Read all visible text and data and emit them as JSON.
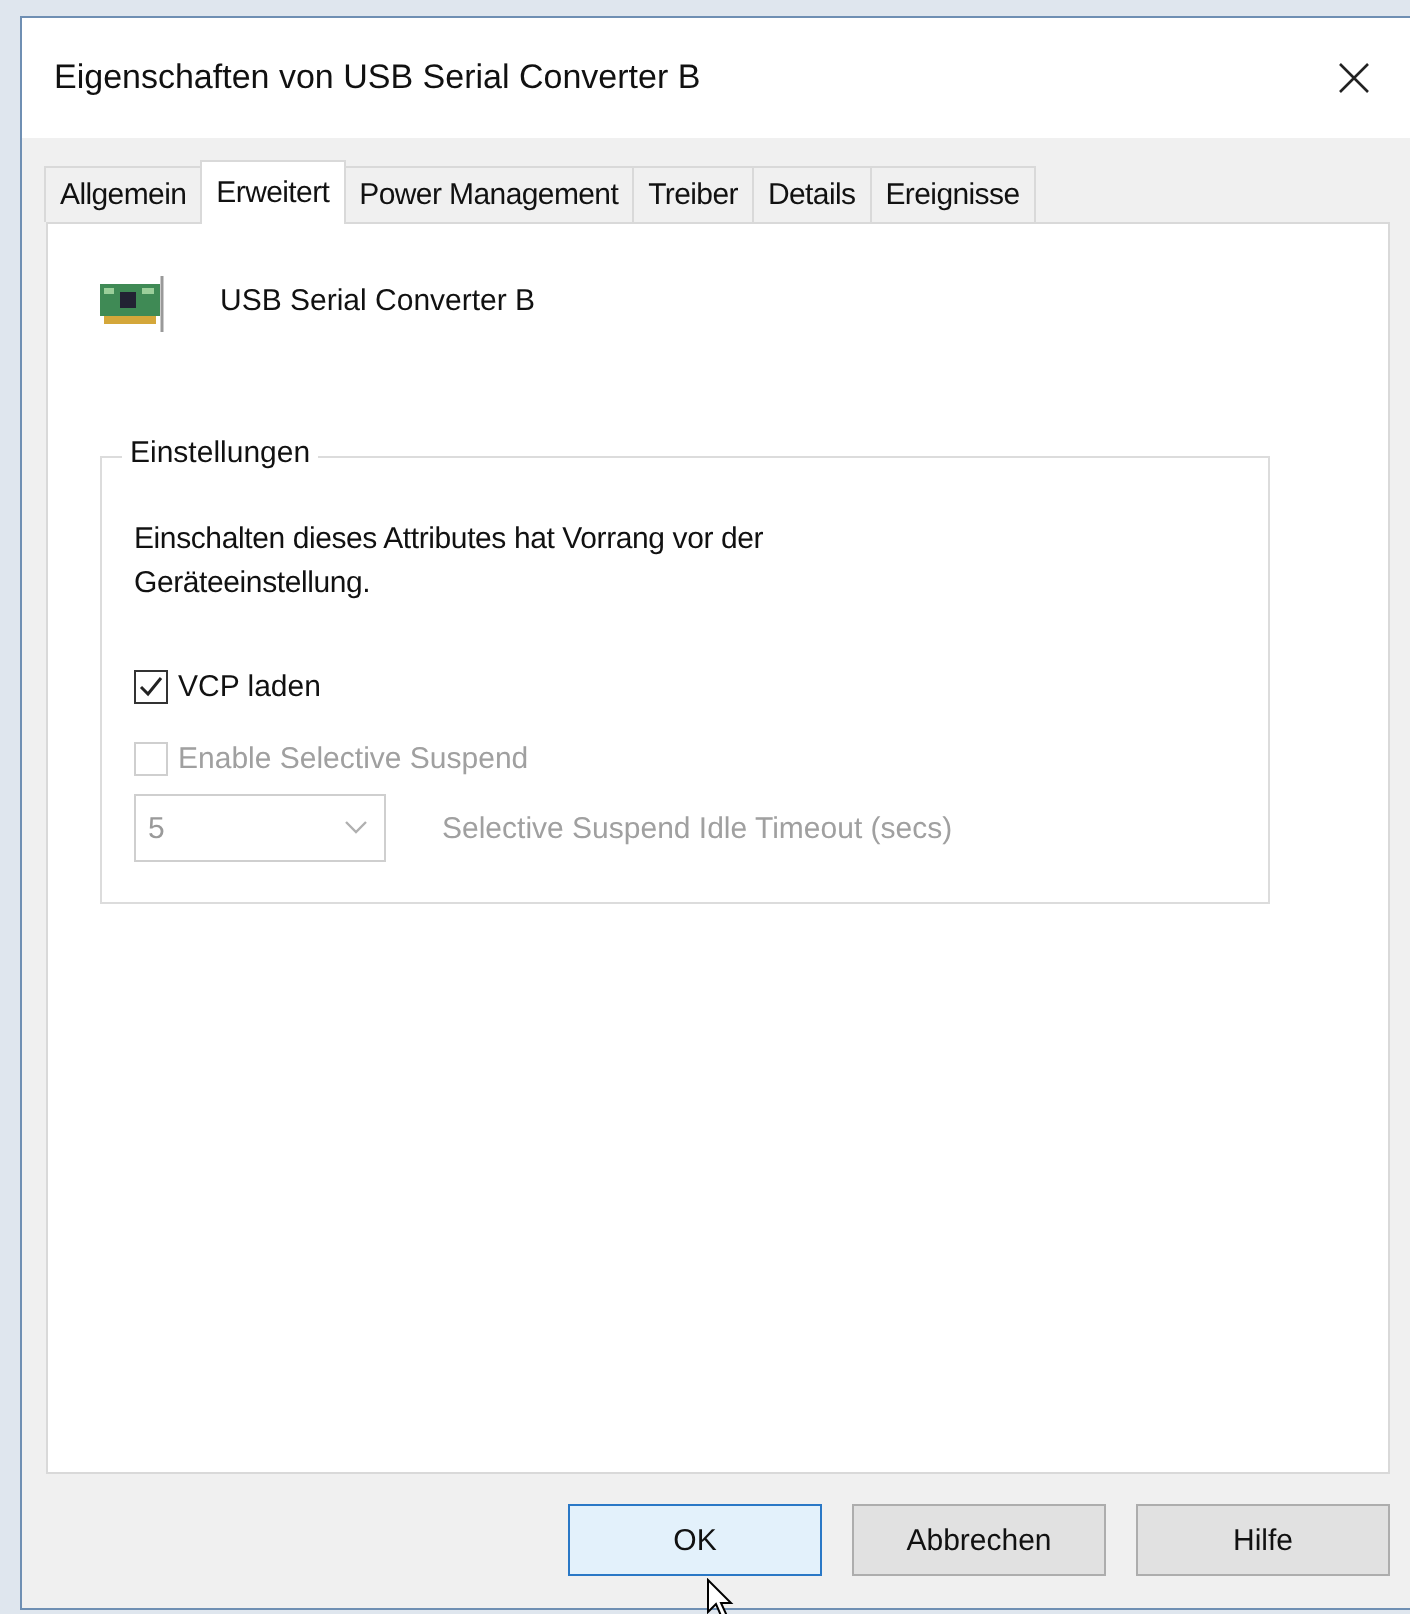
{
  "window": {
    "title": "Eigenschaften von USB Serial Converter B"
  },
  "tabs": [
    {
      "label": "Allgemein",
      "selected": false
    },
    {
      "label": "Erweitert",
      "selected": true
    },
    {
      "label": "Power Management",
      "selected": false
    },
    {
      "label": "Treiber",
      "selected": false
    },
    {
      "label": "Details",
      "selected": false
    },
    {
      "label": "Ereignisse",
      "selected": false
    }
  ],
  "device": {
    "name": "USB Serial Converter B"
  },
  "group": {
    "title": "Einstellungen",
    "description": "Einschalten dieses Attributes hat Vorrang vor der Geräteeinstellung.",
    "checkboxes": [
      {
        "label": "VCP laden",
        "checked": true,
        "disabled": false
      },
      {
        "label": "Enable Selective Suspend",
        "checked": false,
        "disabled": true
      }
    ],
    "timeout": {
      "value": "5",
      "label": "Selective Suspend Idle Timeout (secs)",
      "disabled": true
    }
  },
  "buttons": [
    {
      "label": "OK",
      "default": true
    },
    {
      "label": "Abbrechen",
      "default": false
    },
    {
      "label": "Hilfe",
      "default": false
    }
  ]
}
